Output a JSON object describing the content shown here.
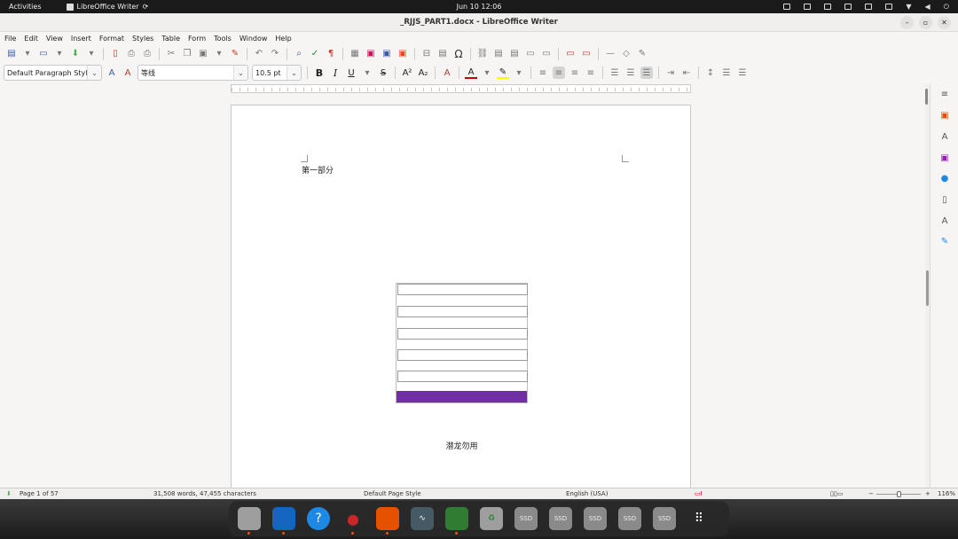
{
  "topbar": {
    "activities": "Activities",
    "app_name": "LibreOffice Writer",
    "datetime": "Jun 10  12:06"
  },
  "window": {
    "title": "_RJJS_PART1.docx - LibreOffice Writer"
  },
  "menu": [
    "File",
    "Edit",
    "View",
    "Insert",
    "Format",
    "Styles",
    "Table",
    "Form",
    "Tools",
    "Window",
    "Help"
  ],
  "format_toolbar": {
    "paragraph_style": "Default Paragraph Styl",
    "font_name": "等线",
    "font_size": "10.5 pt",
    "bold": "B",
    "italic": "I",
    "underline": "U",
    "strike": "S"
  },
  "document": {
    "heading": "第一部分",
    "footer_text": "潜龙勿用",
    "table_cell_count": 5,
    "bar_color": "#7030a0"
  },
  "status": {
    "page": "Page 1 of 57",
    "words": "31,508 words, 47,455 characters",
    "page_style": "Default Page Style",
    "language": "English (USA)",
    "zoom": "116%"
  },
  "dock": {
    "ssd_label": "SSD"
  }
}
